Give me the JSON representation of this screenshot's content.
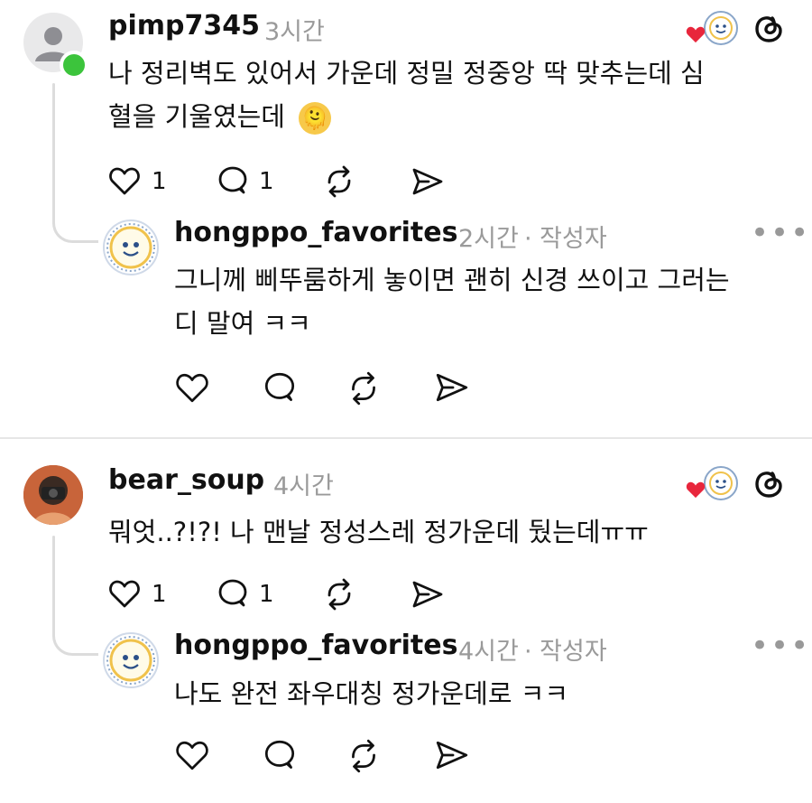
{
  "comments": [
    {
      "username": "pimp7345",
      "time": "3시간",
      "text_line1": "나 정리벽도 있어서 가운데 정밀 정중앙 딱 맞추는데 심",
      "text_line2": "혈을 기울였는데",
      "emoji": "🫠",
      "likes": "1",
      "replies": "1",
      "reply": {
        "username": "hongppo_favorites",
        "time": "2시간",
        "tag": "· 작성자",
        "text_line1": "그니께 삐뚜룸하게 놓이면 괜히 신경 쓰이고 그러는",
        "text_line2": "디 말여 ㅋㅋ"
      }
    },
    {
      "username": "bear_soup",
      "time": "4시간",
      "text_line1": "뭐엇..?!?! 나 맨날 정성스레 정가운데 뒀는데ㅠㅠ",
      "likes": "1",
      "replies": "1",
      "reply": {
        "username": "hongppo_favorites",
        "time": "4시간",
        "tag": "· 작성자",
        "text_line1": "나도 완전 좌우대칭 정가운데로 ㅋㅋ"
      }
    }
  ],
  "more_label": "•••",
  "colors": {
    "online": "#3cc43c",
    "heart": "#e8263c",
    "line": "#dcdcdc"
  }
}
